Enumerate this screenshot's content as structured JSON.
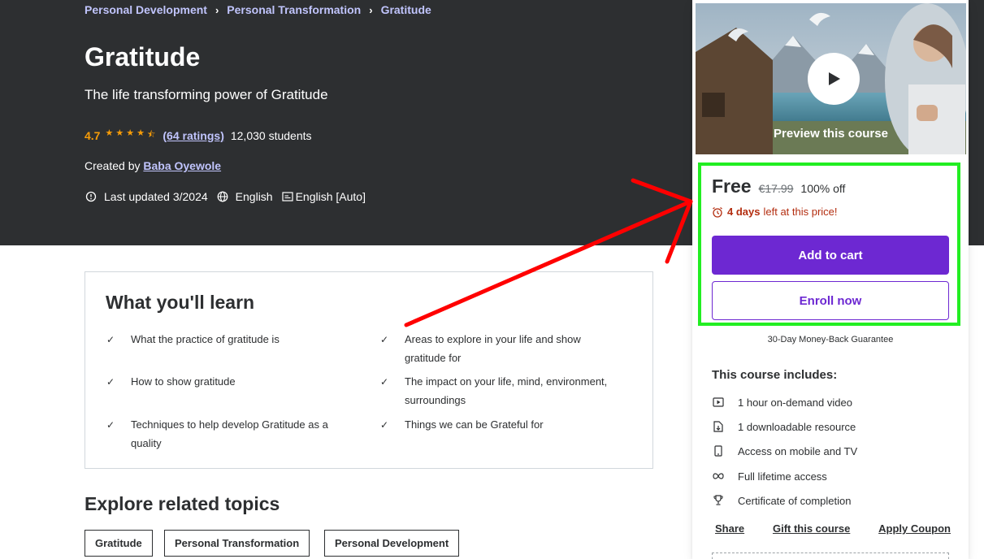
{
  "breadcrumb": {
    "items": [
      "Personal Development",
      "Personal Transformation",
      "Gratitude"
    ],
    "separator": "›"
  },
  "course": {
    "title": "Gratitude",
    "subtitle": "The life transforming power of Gratitude",
    "rating": "4.7",
    "stars_value": 4.5,
    "ratings_link": "(64 ratings)",
    "students": "12,030 students",
    "created_by_label": "Created by",
    "instructor": "Baba Oyewole",
    "last_updated": "Last updated 3/2024",
    "language": "English",
    "captions": "English [Auto]"
  },
  "learn": {
    "heading": "What you'll learn",
    "items": [
      "What the practice of gratitude is",
      "Areas to explore in your life and show gratitude for",
      "How to show gratitude",
      "The impact on your life, mind, environment, surroundings",
      "Techniques to help develop Gratitude as a quality",
      "Things we can be Grateful for"
    ]
  },
  "explore": {
    "heading": "Explore related topics",
    "topics": [
      "Gratitude",
      "Personal Transformation",
      "Personal Development"
    ]
  },
  "sidebar": {
    "preview_label": "Preview this course",
    "price": "Free",
    "original_price": "€17.99",
    "discount": "100% off",
    "timer_bold": "4 days",
    "timer_rest": "left at this price!",
    "add_to_cart": "Add to cart",
    "enroll_now": "Enroll now",
    "guarantee": "30-Day Money-Back Guarantee",
    "includes_title": "This course includes:",
    "includes": [
      {
        "icon": "video-icon",
        "label": "1 hour on-demand video"
      },
      {
        "icon": "file-download-icon",
        "label": "1 downloadable resource"
      },
      {
        "icon": "mobile-icon",
        "label": "Access on mobile and TV"
      },
      {
        "icon": "infinity-icon",
        "label": "Full lifetime access"
      },
      {
        "icon": "trophy-icon",
        "label": "Certificate of completion"
      }
    ],
    "actions": [
      "Share",
      "Gift this course",
      "Apply Coupon"
    ]
  },
  "colors": {
    "hero_bg": "#2d2f31",
    "link_purple_light": "#c0c4fc",
    "star_orange": "#f69c08",
    "brand_purple": "#6d28d2",
    "timer_red": "#b32d0f",
    "annotation_green": "#22ee22",
    "annotation_red": "#ff0000"
  }
}
